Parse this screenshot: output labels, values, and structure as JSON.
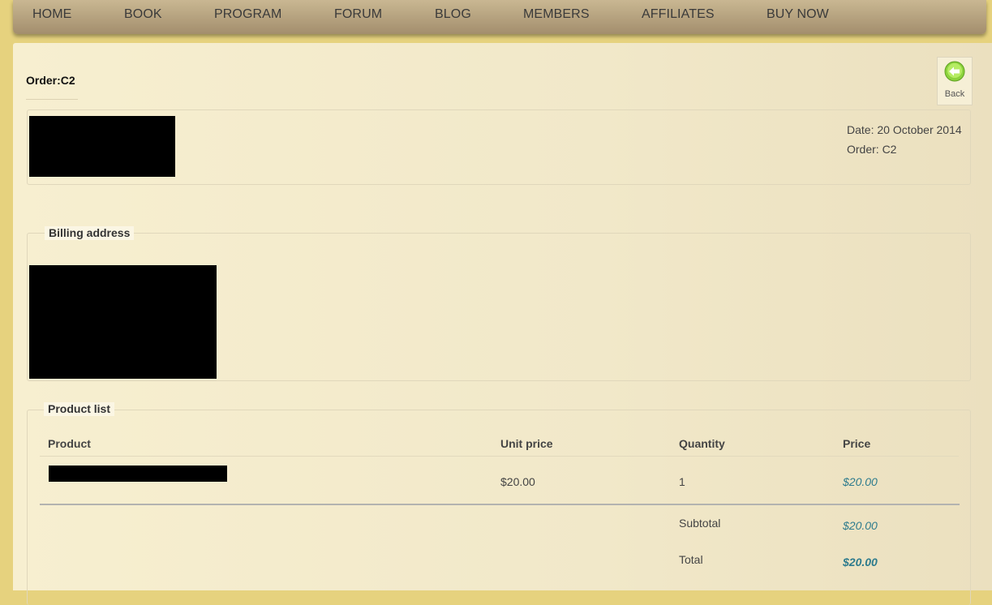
{
  "nav": {
    "items": [
      "HOME",
      "BOOK",
      "PROGRAM",
      "FORUM",
      "BLOG",
      "MEMBERS",
      "AFFILIATES",
      "BUY NOW"
    ]
  },
  "order": {
    "title": "Order:C2",
    "date_line": "Date: 20 October 2014",
    "order_line": "Order: C2"
  },
  "back": {
    "label": "Back",
    "icon": "back-arrow-icon"
  },
  "billing": {
    "legend": "Billing address"
  },
  "products": {
    "legend": "Product list",
    "headers": {
      "product": "Product",
      "unit_price": "Unit price",
      "quantity": "Quantity",
      "price": "Price"
    },
    "rows": [
      {
        "unit_price": "$20.00",
        "quantity": "1",
        "price": "$20.00"
      }
    ],
    "subtotal_label": "Subtotal",
    "subtotal_value": "$20.00",
    "total_label": "Total",
    "total_value": "$20.00"
  },
  "colors": {
    "nav_gradient_top": "#c9b792",
    "nav_gradient_bottom": "#a38e6d",
    "page_bg": "#e6d27e",
    "price_accent": "#2d7b8d",
    "back_icon_green": "#8cd23c"
  }
}
